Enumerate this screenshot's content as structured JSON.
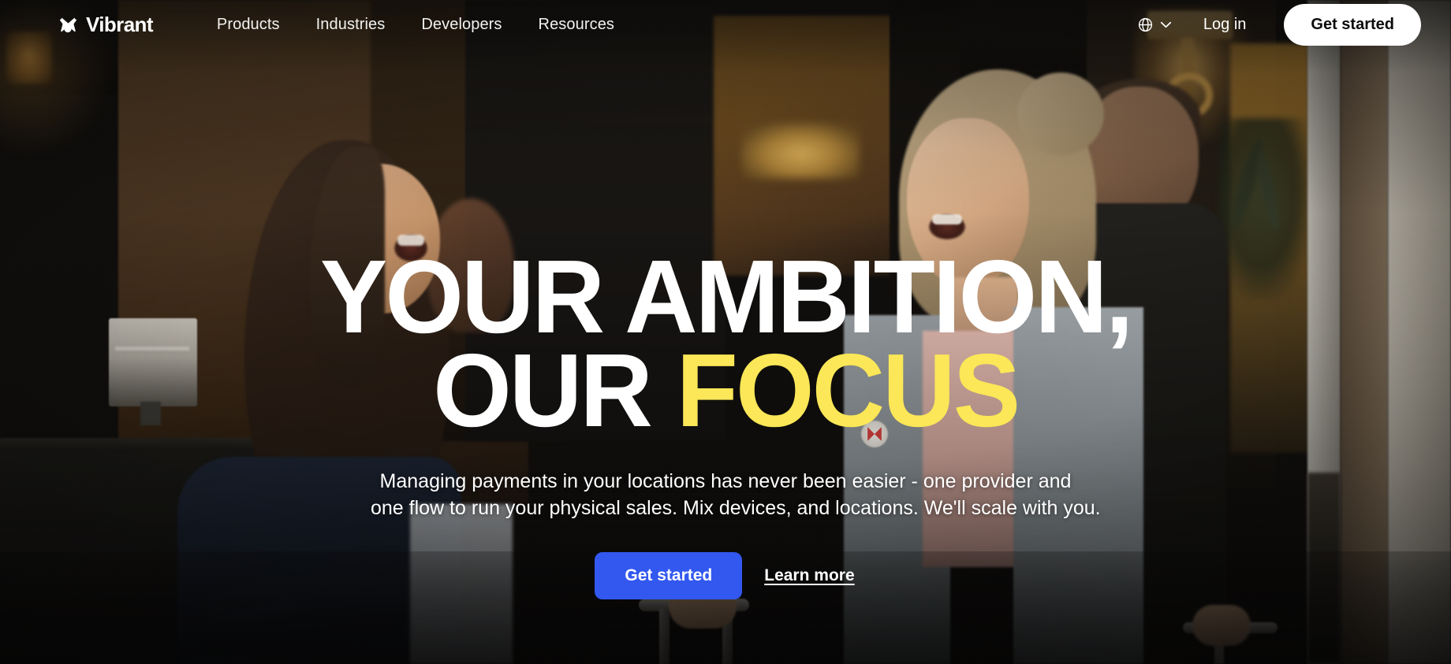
{
  "brand": {
    "name": "Vibrant",
    "logo_icon": "vibrant-butterfly-mark"
  },
  "nav": {
    "items": [
      {
        "label": "Products"
      },
      {
        "label": "Industries"
      },
      {
        "label": "Developers"
      },
      {
        "label": "Resources"
      }
    ]
  },
  "header_right": {
    "language_icon": "globe-icon",
    "language_chevron_icon": "chevron-down-icon",
    "login_label": "Log in",
    "get_started_label": "Get started"
  },
  "hero": {
    "headline_line1": "YOUR AMBITION,",
    "headline_line2_white": "OUR ",
    "headline_line2_accent": "FOCUS",
    "subtitle_line1": "Managing payments in your locations has never been easier - one provider and",
    "subtitle_line2": "one flow to run your physical sales. Mix devices, and locations. We'll scale with you.",
    "primary_cta_label": "Get started",
    "secondary_cta_label": "Learn more"
  },
  "colors": {
    "accent_yellow": "#FBE757",
    "primary_blue": "#3258F0",
    "text_white": "#FFFFFF",
    "button_light": "#FFFFFF",
    "button_light_text": "#0B0B0B"
  }
}
